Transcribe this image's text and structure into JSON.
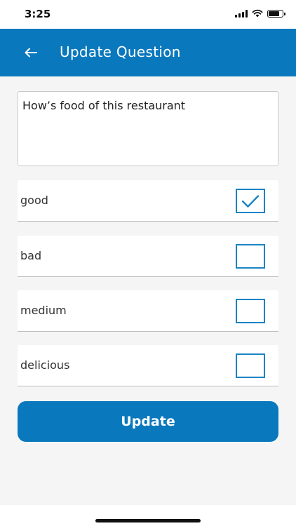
{
  "status_bar": {
    "time": "3:25"
  },
  "header": {
    "title": "Update Question",
    "back_icon": "arrow-left-icon"
  },
  "question": {
    "text": "How’s food of this restaurant"
  },
  "options": [
    {
      "label": "good",
      "checked": true
    },
    {
      "label": "bad",
      "checked": false
    },
    {
      "label": "medium",
      "checked": false
    },
    {
      "label": "delicious",
      "checked": false
    }
  ],
  "actions": {
    "update_label": "Update"
  },
  "colors": {
    "primary": "#0a78bd",
    "checkbox_border": "#1b84c4",
    "background": "#f5f5f5"
  }
}
